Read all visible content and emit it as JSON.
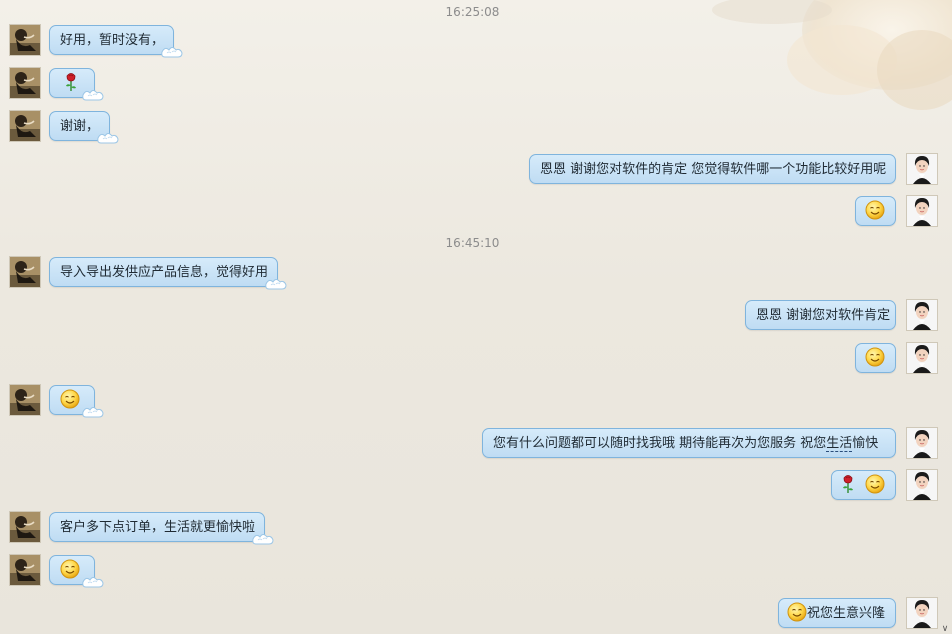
{
  "timestamps": {
    "t1": "16:25:08",
    "t2": "16:45:10"
  },
  "messages": {
    "m1": "好用，暂时没有，",
    "m3": "谢谢，",
    "m4": "恩恩 谢谢您对软件的肯定  您觉得软件哪一个功能比较好用呢",
    "m6": "导入导出发供应产品信息，觉得好用",
    "m7": "恩恩 谢谢您对软件肯定",
    "m10_a": "您有什么问题都可以随时找我哦   期待能再次为您服务  祝您",
    "m10_b": "生活",
    "m10_c": "愉快",
    "m12": "客户多下点订单，生活就更愉快啦",
    "m14": "祝您生意兴隆"
  },
  "icons": {
    "smile": "smile-emoji-icon",
    "rose": "rose-emoji-icon",
    "customer_avatar": "customer-avatar",
    "agent_avatar": "agent-avatar"
  },
  "colors": {
    "bubble_fill": "#c9e3f6",
    "bubble_border": "#7fb4dd",
    "timestamp": "#8c8c8c",
    "background": "#eeeae2"
  }
}
